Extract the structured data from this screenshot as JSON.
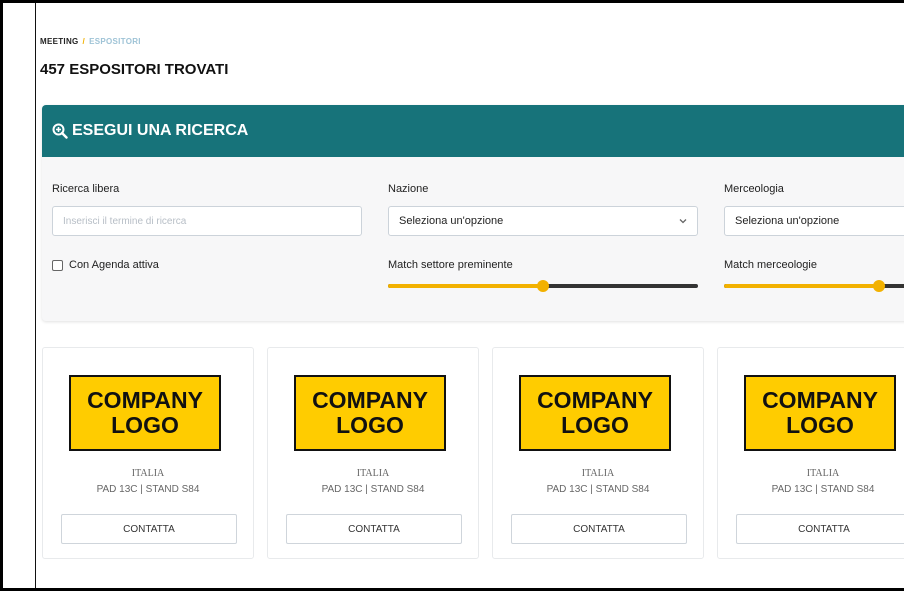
{
  "breadcrumb": {
    "root": "MEETING",
    "separator": "/",
    "current": "ESPOSITORI"
  },
  "page_title": "457 ESPOSITORI TROVATI",
  "search": {
    "header_title": "ESEGUI UNA RICERCA",
    "free_search": {
      "label": "Ricerca libera",
      "placeholder": "Inserisci il termine di ricerca",
      "value": ""
    },
    "nation": {
      "label": "Nazione",
      "selected": "Seleziona un'opzione"
    },
    "category": {
      "label": "Merceologia",
      "selected": "Seleziona un'opzione"
    },
    "agenda_checkbox": {
      "label": "Con Agenda attiva",
      "checked": false
    },
    "sector_match": {
      "label": "Match settore preminente",
      "value_percent": 50
    },
    "category_match": {
      "label": "Match merceologie",
      "value_percent": 50
    }
  },
  "exhibitors": [
    {
      "logo_line1": "COMPANY",
      "logo_line2": "LOGO",
      "country": "ITALIA",
      "stand": "PAD 13C | STAND S84",
      "contact_label": "CONTATTA"
    },
    {
      "logo_line1": "COMPANY",
      "logo_line2": "LOGO",
      "country": "ITALIA",
      "stand": "PAD 13C | STAND S84",
      "contact_label": "CONTATTA"
    },
    {
      "logo_line1": "COMPANY",
      "logo_line2": "LOGO",
      "country": "ITALIA",
      "stand": "PAD 13C | STAND S84",
      "contact_label": "CONTATTA"
    },
    {
      "logo_line1": "COMPANY",
      "logo_line2": "LOGO",
      "country": "ITALIA",
      "stand": "PAD 13C | STAND S84",
      "contact_label": "CONTATTA"
    }
  ],
  "colors": {
    "header_bg": "#17737a",
    "accent": "#f2b100",
    "logo_bg": "#ffcc00"
  },
  "icons": {
    "search_header": "zoom-in-icon",
    "select": "chevron-down-icon"
  }
}
